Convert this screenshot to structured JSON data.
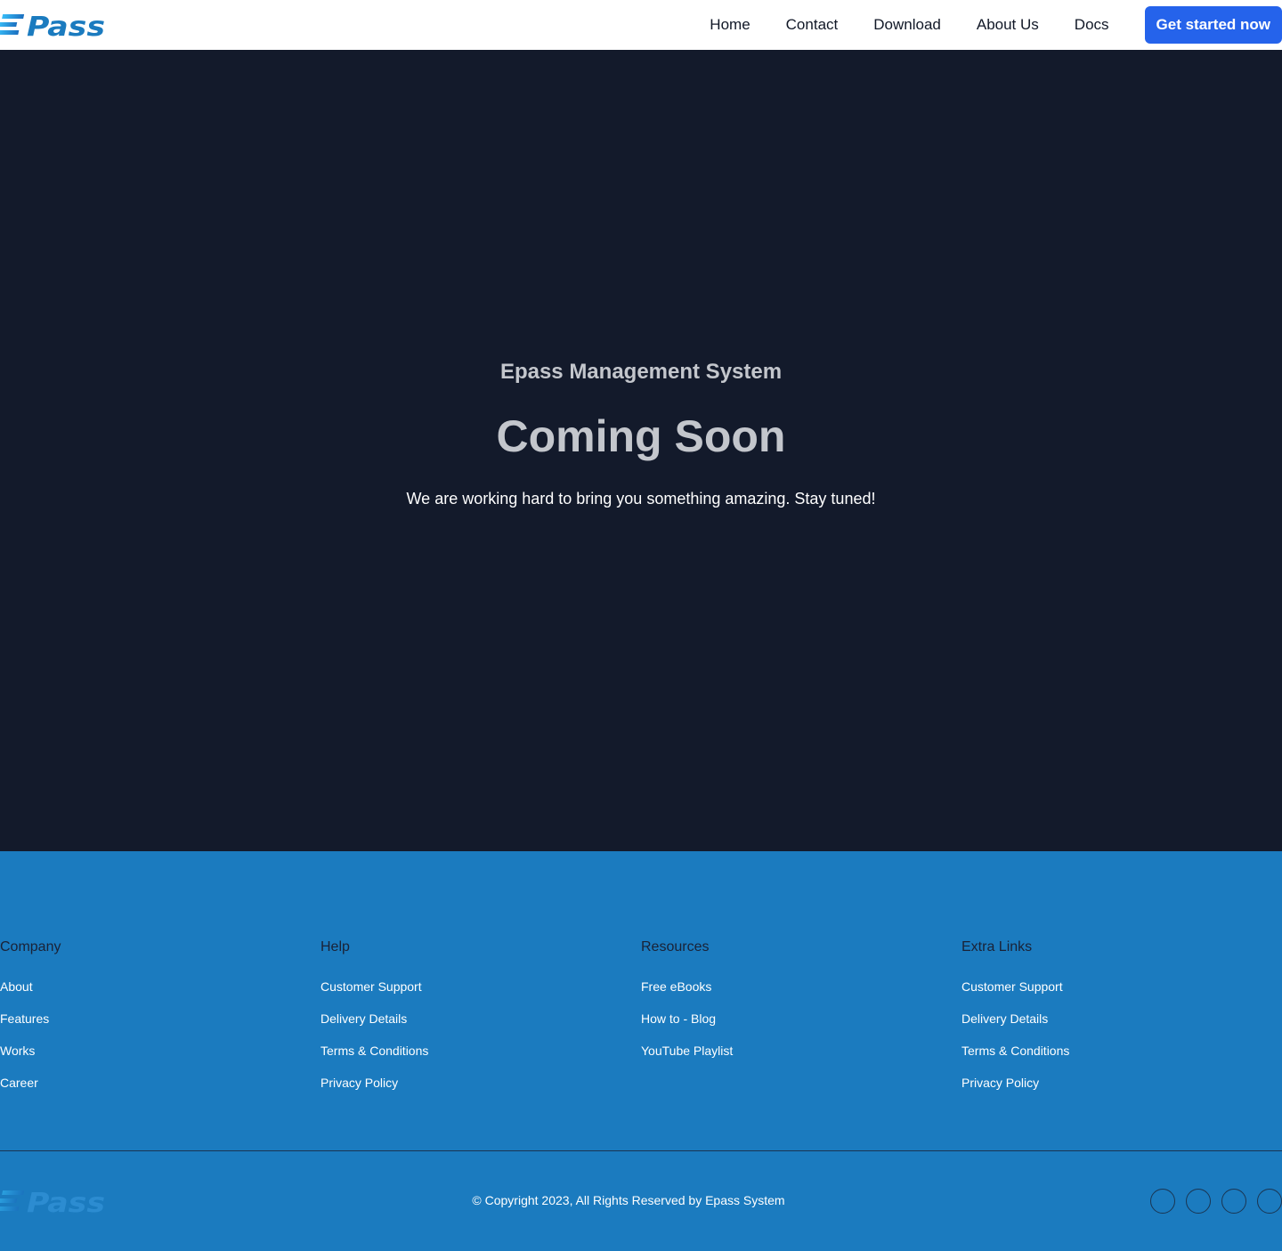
{
  "brand": {
    "logo_text": "EPass",
    "color": "#1b7bbf"
  },
  "nav": {
    "links": [
      "Home",
      "Contact",
      "Download",
      "About Us",
      "Docs"
    ],
    "cta": "Get started now",
    "cta_color": "#2563eb"
  },
  "hero": {
    "subtitle": "Epass Management System",
    "title": "Coming Soon",
    "text": "We are working hard to bring you something amazing. Stay tuned!",
    "background": "#131a2b"
  },
  "footer": {
    "background": "#1b7bbf",
    "columns": [
      {
        "heading": "Company",
        "links": [
          "About",
          "Features",
          "Works",
          "Career"
        ]
      },
      {
        "heading": "Help",
        "links": [
          "Customer Support",
          "Delivery Details",
          "Terms & Conditions",
          "Privacy Policy"
        ]
      },
      {
        "heading": "Resources",
        "links": [
          "Free eBooks",
          "How to - Blog",
          "YouTube Playlist"
        ]
      },
      {
        "heading": "Extra Links",
        "links": [
          "Customer Support",
          "Delivery Details",
          "Terms & Conditions",
          "Privacy Policy"
        ]
      }
    ],
    "copyright": "© Copyright 2023, All Rights Reserved by Epass System",
    "socials": [
      "social-icon-1",
      "social-icon-2",
      "social-icon-3",
      "social-icon-4"
    ]
  }
}
